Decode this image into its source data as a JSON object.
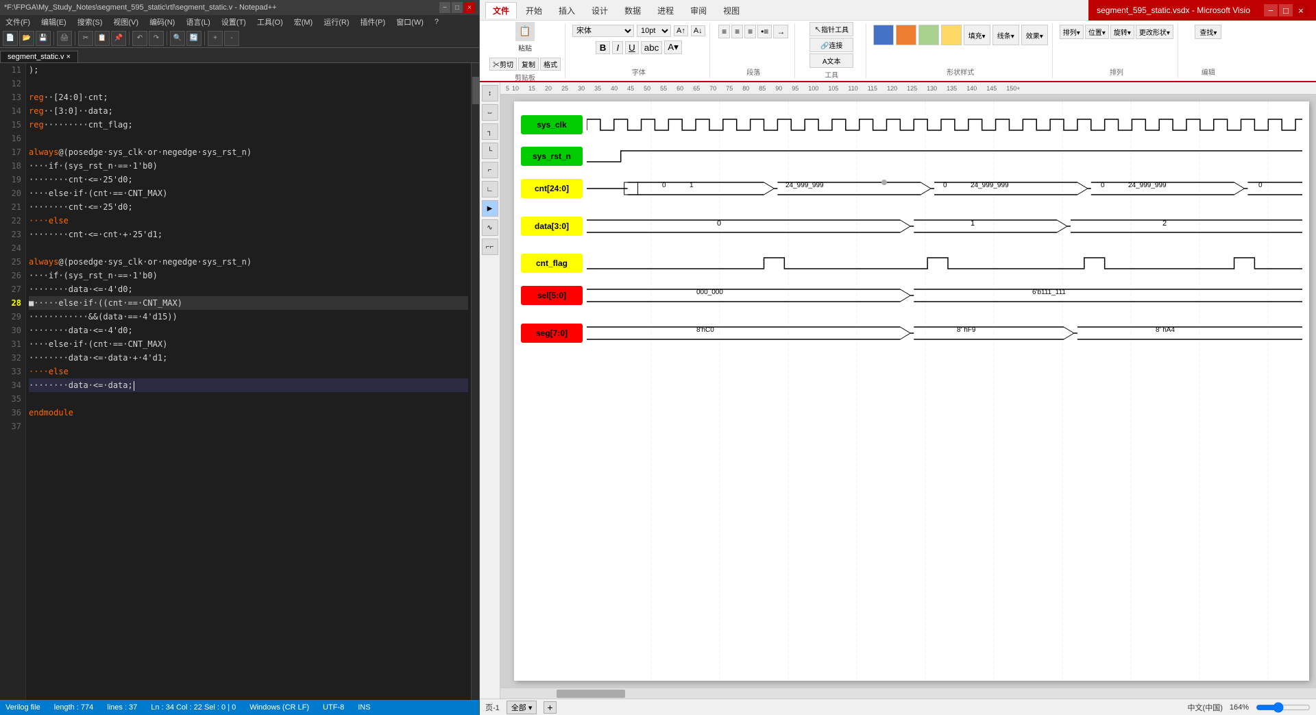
{
  "notepad": {
    "titlebar": {
      "title": "*F:\\FPGA\\My_Study_Notes\\segment_595_static\\rtl\\segment_static.v - Notepad++",
      "min": "−",
      "max": "□",
      "close": "×"
    },
    "menubar": [
      "文件(F)",
      "编辑(E)",
      "搜索(S)",
      "视图(V)",
      "编码(N)",
      "语言(L)",
      "设置(T)",
      "工具(O)",
      "宏(M)",
      "运行(R)",
      "插件(P)",
      "窗口(W)",
      "?"
    ],
    "tab": "segment_static.v",
    "lines": [
      {
        "num": "11",
        "code": [
          {
            "t": ");",
            "c": "id"
          }
        ]
      },
      {
        "num": "12",
        "code": []
      },
      {
        "num": "13",
        "code": [
          {
            "t": "reg",
            "c": "kw"
          },
          {
            "t": "··[24:0]·cnt;",
            "c": "id"
          }
        ]
      },
      {
        "num": "14",
        "code": [
          {
            "t": "reg",
            "c": "kw"
          },
          {
            "t": "··[3:0]··data;",
            "c": "id"
          }
        ]
      },
      {
        "num": "15",
        "code": [
          {
            "t": "reg",
            "c": "kw"
          },
          {
            "t": "·········cnt_flag;",
            "c": "id"
          }
        ]
      },
      {
        "num": "16",
        "code": []
      },
      {
        "num": "17",
        "code": [
          {
            "t": "always",
            "c": "kw"
          },
          {
            "t": "@(posedge·sys_clk·or·negedge·sys_rst_n)",
            "c": "id"
          }
        ]
      },
      {
        "num": "18",
        "code": [
          {
            "t": "····if·(sys_rst_n·==·1'b0)",
            "c": "id"
          }
        ]
      },
      {
        "num": "19",
        "code": [
          {
            "t": "········cnt·<=·25'd0;",
            "c": "id"
          }
        ]
      },
      {
        "num": "20",
        "code": [
          {
            "t": "····else·if·(cnt·==·CNT_MAX)",
            "c": "id"
          }
        ]
      },
      {
        "num": "21",
        "code": [
          {
            "t": "········cnt·<=·25'd0;",
            "c": "id"
          }
        ]
      },
      {
        "num": "22",
        "code": [
          {
            "t": "····else",
            "c": "kw"
          }
        ]
      },
      {
        "num": "23",
        "code": [
          {
            "t": "········cnt·<=·cnt·+·25'd1;",
            "c": "id"
          }
        ]
      },
      {
        "num": "24",
        "code": []
      },
      {
        "num": "25",
        "code": [
          {
            "t": "always",
            "c": "kw"
          },
          {
            "t": "@(posedge·sys_clk·or·negedge·sys_rst_n)",
            "c": "id"
          }
        ]
      },
      {
        "num": "26",
        "code": [
          {
            "t": "····if·(sys_rst_n·==·1'b0)",
            "c": "id"
          }
        ]
      },
      {
        "num": "27",
        "code": [
          {
            "t": "········data·<=·4'd0;",
            "c": "id"
          }
        ]
      },
      {
        "num": "28",
        "code": [
          {
            "t": "····else·if·((cnt·==·CNT_MAX)",
            "c": "id"
          }
        ]
      },
      {
        "num": "29",
        "code": [
          {
            "t": "············&&(data·==·4'd15))",
            "c": "id"
          }
        ]
      },
      {
        "num": "30",
        "code": [
          {
            "t": "········data·<=·4'd0;",
            "c": "id"
          }
        ]
      },
      {
        "num": "31",
        "code": [
          {
            "t": "····else·if·(cnt·==·CNT_MAX)",
            "c": "id"
          }
        ]
      },
      {
        "num": "32",
        "code": [
          {
            "t": "········data·<=·data·+·4'd1;",
            "c": "id"
          }
        ]
      },
      {
        "num": "33",
        "code": [
          {
            "t": "····else",
            "c": "kw"
          }
        ]
      },
      {
        "num": "34",
        "code": [
          {
            "t": "········data·<=·data;",
            "c": "id"
          }
        ]
      },
      {
        "num": "35",
        "code": []
      },
      {
        "num": "36",
        "code": [
          {
            "t": "endmodule",
            "c": "kw"
          }
        ]
      },
      {
        "num": "37",
        "code": []
      }
    ],
    "statusbar": {
      "filetype": "Verilog file",
      "length": "length : 774",
      "lines": "lines : 37",
      "position": "Ln : 34    Col : 22    Sel : 0 | 0",
      "encoding": "Windows (CR LF)",
      "charset": "UTF-8",
      "mode": "INS"
    }
  },
  "visio": {
    "titlebar": {
      "title": "segment_595_static.vsdx - Microsoft Visio",
      "min": "−",
      "max": "□",
      "close": "×"
    },
    "ribbon_tabs": [
      "文件",
      "开始",
      "插入",
      "设计",
      "数据",
      "进程",
      "审阅",
      "视图"
    ],
    "active_tab": "文件",
    "ribbon_groups": {
      "clipboard": "剪贴板",
      "font": "字体",
      "paragraph": "段落",
      "tools": "工具",
      "shape_styles": "形状样式",
      "arrange": "排列",
      "editing": "编辑"
    },
    "signals": [
      {
        "name": "sys_clk",
        "color": "green",
        "type": "clock",
        "wave_desc": "clock signal"
      },
      {
        "name": "sys_rst_n",
        "color": "green",
        "type": "reset",
        "wave_desc": "reset signal"
      },
      {
        "name": "cnt[24:0]",
        "color": "yellow",
        "type": "data",
        "values": [
          "0",
          "1",
          "24_999_999",
          "0",
          "24_999_999",
          "0",
          "24_999_999",
          "0"
        ]
      },
      {
        "name": "data[3:0]",
        "color": "yellow",
        "type": "data",
        "values": [
          "0",
          "1",
          "2"
        ]
      },
      {
        "name": "cnt_flag",
        "color": "yellow",
        "type": "pulse",
        "wave_desc": "flag signal"
      },
      {
        "name": "sel[5:0]",
        "color": "red",
        "type": "data",
        "values": [
          "000_000",
          "6'b111_111"
        ]
      },
      {
        "name": "seg[7:0]",
        "color": "red",
        "type": "data",
        "values": [
          "8'hC0",
          "8'hF9",
          "8'hA4"
        ]
      }
    ],
    "statusbar": {
      "page": "页-1",
      "view": "全部",
      "zoom": "164%",
      "language": "中文(中国)"
    }
  }
}
